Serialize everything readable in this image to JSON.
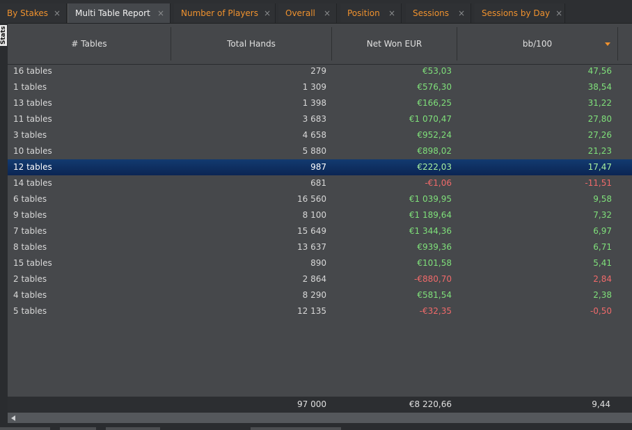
{
  "tabs": [
    {
      "label": "By Stakes",
      "active": false
    },
    {
      "label": "Multi Table Report",
      "active": true
    },
    {
      "label": "Number of Players",
      "active": false
    },
    {
      "label": "Overall",
      "active": false
    },
    {
      "label": "Position",
      "active": false
    },
    {
      "label": "Sessions",
      "active": false
    },
    {
      "label": "Sessions by Day",
      "active": false
    }
  ],
  "close_glyph": "×",
  "side_tab": "Stats",
  "columns": [
    "# Tables",
    "Total Hands",
    "Net Won EUR",
    "bb/100"
  ],
  "rows": [
    {
      "tables": "16 tables",
      "hands": "279",
      "net": "€53,03",
      "bb": "47,56",
      "neg": false
    },
    {
      "tables": "1 tables",
      "hands": "1 309",
      "net": "€576,30",
      "bb": "38,54",
      "neg": false
    },
    {
      "tables": "13 tables",
      "hands": "1 398",
      "net": "€166,25",
      "bb": "31,22",
      "neg": false
    },
    {
      "tables": "11 tables",
      "hands": "3 683",
      "net": "€1 070,47",
      "bb": "27,80",
      "neg": false
    },
    {
      "tables": "3 tables",
      "hands": "4 658",
      "net": "€952,24",
      "bb": "27,26",
      "neg": false
    },
    {
      "tables": "10 tables",
      "hands": "5 880",
      "net": "€898,02",
      "bb": "21,23",
      "neg": false
    },
    {
      "tables": "12 tables",
      "hands": "987",
      "net": "€222,03",
      "bb": "17,47",
      "neg": false,
      "selected": true
    },
    {
      "tables": "14 tables",
      "hands": "681",
      "net": "-€1,06",
      "bb": "-11,51",
      "neg": true
    },
    {
      "tables": "6 tables",
      "hands": "16 560",
      "net": "€1 039,95",
      "bb": "9,58",
      "neg": false
    },
    {
      "tables": "9 tables",
      "hands": "8 100",
      "net": "€1 189,64",
      "bb": "7,32",
      "neg": false
    },
    {
      "tables": "7 tables",
      "hands": "15 649",
      "net": "€1 344,36",
      "bb": "6,97",
      "neg": false
    },
    {
      "tables": "8 tables",
      "hands": "13 637",
      "net": "€939,36",
      "bb": "6,71",
      "neg": false
    },
    {
      "tables": "15 tables",
      "hands": "890",
      "net": "€101,58",
      "bb": "5,41",
      "neg": false
    },
    {
      "tables": "2 tables",
      "hands": "2 864",
      "net": "-€880,70",
      "bb": "2,84",
      "neg": true
    },
    {
      "tables": "4 tables",
      "hands": "8 290",
      "net": "€581,54",
      "bb": "2,38",
      "neg": false
    },
    {
      "tables": "5 tables",
      "hands": "12 135",
      "net": "-€32,35",
      "bb": "-0,50",
      "neg": true
    }
  ],
  "totals": {
    "hands": "97 000",
    "net": "€8 220,66",
    "bb": "9,44"
  },
  "colors": {
    "accent": "#f0922e",
    "positive": "#7fe07a",
    "negative": "#f06a6a",
    "selected": "#0b2553"
  }
}
